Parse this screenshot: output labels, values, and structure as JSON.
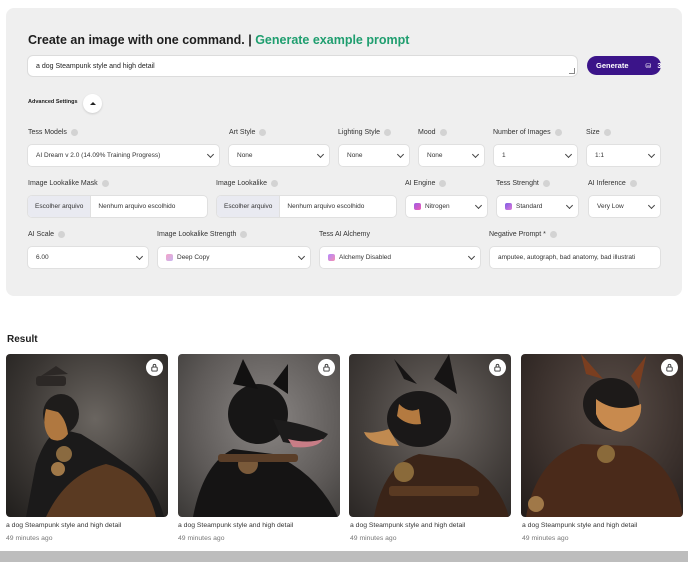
{
  "header": {
    "title": "Create an image with one command. |",
    "example_link": "Generate example prompt"
  },
  "prompt": {
    "value": "a dog Steampunk style and high detail"
  },
  "generate": {
    "label": "Generate",
    "credits": "3",
    "icon": "coins-icon"
  },
  "advanced": {
    "label": "Advanced Settings",
    "expanded": true
  },
  "fields": {
    "tess_models": {
      "label": "Tess Models",
      "value": "AI Dream v 2.0 (14.09% Training Progress)"
    },
    "art_style": {
      "label": "Art Style",
      "value": "None"
    },
    "lighting_style": {
      "label": "Lighting Style",
      "value": "None"
    },
    "mood": {
      "label": "Mood",
      "value": "None"
    },
    "num_images": {
      "label": "Number of Images",
      "value": "1"
    },
    "size": {
      "label": "Size",
      "value": "1:1"
    },
    "lookalike_mask": {
      "label": "Image Lookalike Mask",
      "button": "Escolher arquivo",
      "status": "Nenhum arquivo escolhido"
    },
    "lookalike": {
      "label": "Image Lookalike",
      "button": "Escolher arquivo",
      "status": "Nenhum arquivo escolhido"
    },
    "ai_engine": {
      "label": "AI Engine",
      "value": "Nitrogen"
    },
    "tess_strength": {
      "label": "Tess Strenght",
      "value": "Standard"
    },
    "ai_inference": {
      "label": "AI Inference",
      "value": "Very Low"
    },
    "ai_scale": {
      "label": "AI Scale",
      "value": "6.00"
    },
    "lookalike_strength": {
      "label": "Image Lookalike Strength",
      "value": "Deep Copy"
    },
    "alchemy": {
      "label": "Tess AI Alchemy",
      "value": "Alchemy Disabled"
    },
    "negative_prompt": {
      "label": "Negative Prompt *",
      "value": "amputee, autograph, bad anatomy, bad illustrati"
    }
  },
  "colors": {
    "accent": "#3b1489",
    "link": "#1f9e6f",
    "panel": "#efefef"
  },
  "result": {
    "title": "Result",
    "items": [
      {
        "caption": "a dog Steampunk style and high detail",
        "time": "49 minutes ago"
      },
      {
        "caption": "a dog Steampunk style and high detail",
        "time": "49 minutes ago"
      },
      {
        "caption": "a dog Steampunk style and high detail",
        "time": "49 minutes ago"
      },
      {
        "caption": "a dog Steampunk style and high detail",
        "time": "49 minutes ago"
      }
    ]
  }
}
